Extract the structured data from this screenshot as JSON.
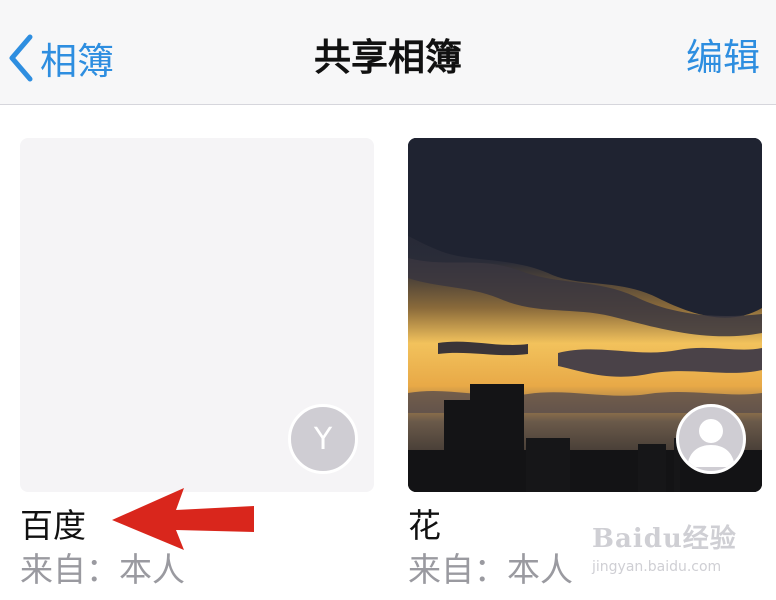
{
  "navbar": {
    "back_label": "相簿",
    "title": "共享相簿",
    "edit_label": "编辑"
  },
  "albums": [
    {
      "name": "百度",
      "owner": "来自：本人",
      "avatar_letter": "Y",
      "thumbnail": "blank"
    },
    {
      "name": "花",
      "owner": "来自：本人",
      "avatar_letter": "",
      "thumbnail": "sunset-photo"
    }
  ],
  "watermark": {
    "logo": "Baidu经验",
    "url": "jingyan.baidu.com"
  },
  "colors": {
    "accent": "#2e8ee0",
    "arrow": "#d9261c",
    "secondary_text": "#9a9aa0"
  },
  "icons": [
    "chevron-left-icon",
    "person-silhouette-icon",
    "annotation-arrow"
  ]
}
